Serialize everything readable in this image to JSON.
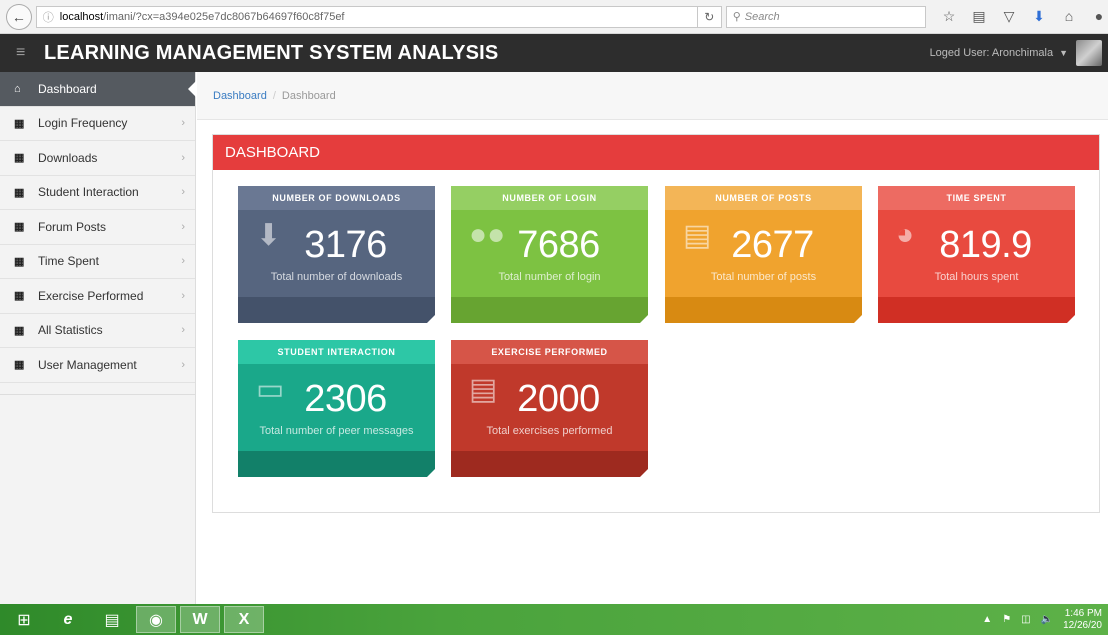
{
  "browser": {
    "url_host": "localhost",
    "url_path": "/imani/?cx=a394e025e7dc8067b64697f60c8f75ef",
    "search_placeholder": "Search",
    "reload_icon": "reload-icon",
    "tool_icons": [
      "star-icon",
      "reading-list-icon",
      "pocket-icon",
      "download-icon",
      "home-icon",
      "chat-icon"
    ]
  },
  "header": {
    "title": "LEARNING MANAGEMENT SYSTEM ANALYSIS",
    "user_label": "Loged User: Aronchimala",
    "background": "#2d2d2d"
  },
  "sidebar": {
    "items": [
      {
        "label": "Dashboard",
        "icon": "home-icon",
        "active": true
      },
      {
        "label": "Login Frequency",
        "icon": "grid-icon"
      },
      {
        "label": "Downloads",
        "icon": "grid-icon"
      },
      {
        "label": "Student Interaction",
        "icon": "grid-icon"
      },
      {
        "label": "Forum Posts",
        "icon": "grid-icon"
      },
      {
        "label": "Time Spent",
        "icon": "grid-icon"
      },
      {
        "label": "Exercise Performed",
        "icon": "grid-icon"
      },
      {
        "label": "All Statistics",
        "icon": "grid-icon"
      },
      {
        "label": "User Management",
        "icon": "grid-icon"
      }
    ]
  },
  "breadcrumb": {
    "link": "Dashboard",
    "separator": "/",
    "current": "Dashboard"
  },
  "panel": {
    "title": "DASHBOARD",
    "accent": "#e53d3d"
  },
  "tiles": [
    {
      "title": "NUMBER OF DOWNLOADS",
      "value": "3176",
      "subtitle": "Total number of downloads",
      "icon": "download-icon",
      "color": "#56657f",
      "head_color": "#6a7893",
      "foot_color": "#44526a"
    },
    {
      "title": "NUMBER OF LOGIN",
      "value": "7686",
      "subtitle": "Total number of login",
      "icon": "users-icon",
      "color": "#7dc242",
      "head_color": "#95cf63",
      "foot_color": "#67a431"
    },
    {
      "title": "NUMBER OF POSTS",
      "value": "2677",
      "subtitle": "Total number of posts",
      "icon": "book-icon",
      "color": "#f0a32e",
      "head_color": "#f3b557",
      "foot_color": "#d88a12"
    },
    {
      "title": "TIME SPENT",
      "value": "819.9",
      "subtitle": "Total hours spent",
      "icon": "dashboard-gauge-icon",
      "color": "#e84a3f",
      "head_color": "#ed6b62",
      "foot_color": "#d02f24"
    },
    {
      "title": "STUDENT INTERACTION",
      "value": "2306",
      "subtitle": "Total number of peer messages",
      "icon": "laptop-icon",
      "color": "#1aa88a",
      "head_color": "#2dc7a6",
      "foot_color": "#128069"
    },
    {
      "title": "EXERCISE PERFORMED",
      "value": "2000",
      "subtitle": "Total exercises performed",
      "icon": "book-icon",
      "color": "#c0392b",
      "head_color": "#d65548",
      "foot_color": "#9e2a1f"
    }
  ],
  "taskbar": {
    "apps": [
      "windows-start-icon",
      "internet-explorer-icon",
      "file-explorer-icon",
      "firefox-icon",
      "word-icon",
      "excel-icon"
    ],
    "time": "1:46 PM",
    "date": "12/26/20"
  }
}
